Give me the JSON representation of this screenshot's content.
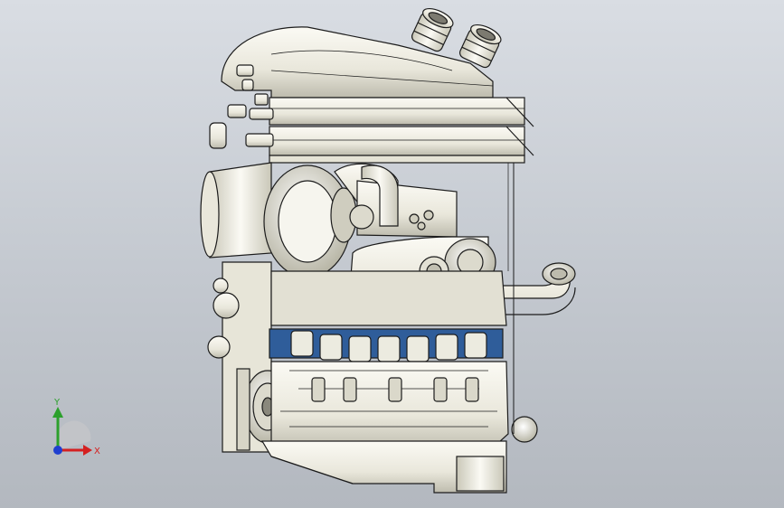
{
  "viewport": {
    "background_top": "#d9dde3",
    "background_bottom": "#b3b8bf",
    "model_fill": "#f2f1e8",
    "model_shade": "#cfcdbf",
    "edge_color": "#1c1c1c",
    "coil_color": "#2f5d9a"
  },
  "triad": {
    "x_label": "X",
    "y_label": "Y",
    "x_color": "#d42020",
    "y_color": "#2ca02c",
    "z_color": "#1f3fd0"
  }
}
